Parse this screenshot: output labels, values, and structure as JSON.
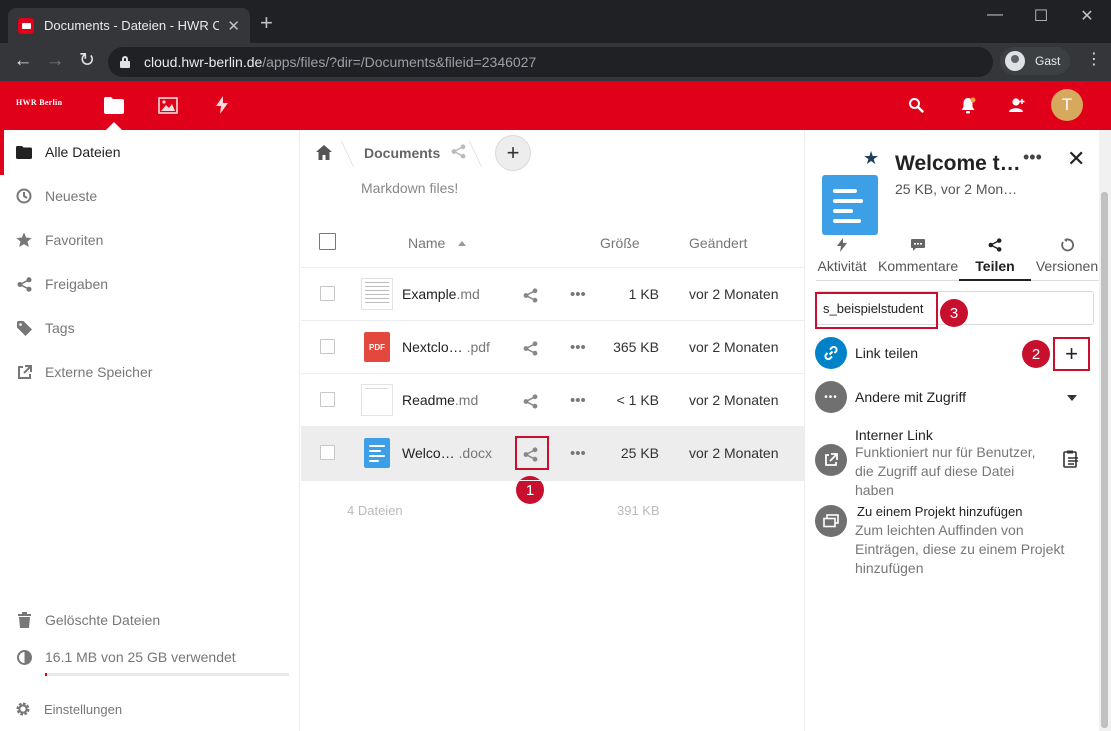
{
  "browser": {
    "tab_title": "Documents - Dateien - HWR Clou",
    "new_tab": "+",
    "url_host": "cloud.hwr-berlin.de",
    "url_path": "/apps/files/?dir=/Documents&fileid=2346027",
    "profile": "Gast",
    "colors": {
      "frame": "#202124",
      "toolbar": "#35363a"
    }
  },
  "app": {
    "logo": "HWR Berlin",
    "brand_color": "#e1001a",
    "header_icons": [
      "files-icon",
      "photos-icon",
      "activity-icon",
      "search-icon",
      "notifications-icon",
      "contacts-icon"
    ],
    "avatar_letter": "T"
  },
  "nav": {
    "items": [
      {
        "label": "Alle Dateien",
        "icon": "folder-icon"
      },
      {
        "label": "Neueste",
        "icon": "clock-icon"
      },
      {
        "label": "Favoriten",
        "icon": "star-icon"
      },
      {
        "label": "Freigaben",
        "icon": "share-icon"
      },
      {
        "label": "Tags",
        "icon": "tag-icon"
      },
      {
        "label": "Externe Speicher",
        "icon": "external-icon"
      }
    ],
    "deleted": "Gelöschte Dateien",
    "quota": "16.1 MB von 25 GB verwendet",
    "quota_fraction": 0.0006,
    "settings": "Einstellungen"
  },
  "files": {
    "breadcrumb": "Documents",
    "rich_workspace": "Markdown files!",
    "columns": {
      "name": "Name",
      "size": "Größe",
      "modified": "Geändert"
    },
    "rows": [
      {
        "name": "Example",
        "ext": ".md",
        "size": "1 KB",
        "modified": "vor 2 Monaten",
        "type": "md"
      },
      {
        "name": "Nextclo…",
        "ext": " .pdf",
        "size": "365 KB",
        "modified": "vor 2 Monaten",
        "type": "pdf"
      },
      {
        "name": "Readme",
        "ext": ".md",
        "size": "< 1 KB",
        "modified": "vor 2 Monaten",
        "type": "md"
      },
      {
        "name": "Welco…",
        "ext": " .docx",
        "size": "25 KB",
        "modified": "vor 2 Monaten",
        "type": "docx"
      }
    ],
    "summary_count": "4 Dateien",
    "summary_size": "391 KB",
    "pdf_label": "PDF"
  },
  "sidebar": {
    "title": "Welcome t…",
    "subtitle": "25 KB, vor 2 Mon…",
    "tabs": [
      "Aktivität",
      "Kommentare",
      "Teilen",
      "Versionen"
    ],
    "share_input": "s_beispielstudent",
    "link_share": "Link teilen",
    "others": "Andere mit Zugriff",
    "internal_link_title": "Interner Link",
    "internal_link_desc": "Funktioniert nur für Benutzer, die Zugriff auf diese Datei haben",
    "project_title": "Zu einem Projekt hinzufügen",
    "project_desc": "Zum leichten Auffinden von Einträgen, diese zu einem Projekt hinzufügen"
  },
  "annotations": [
    "1",
    "2",
    "3"
  ]
}
